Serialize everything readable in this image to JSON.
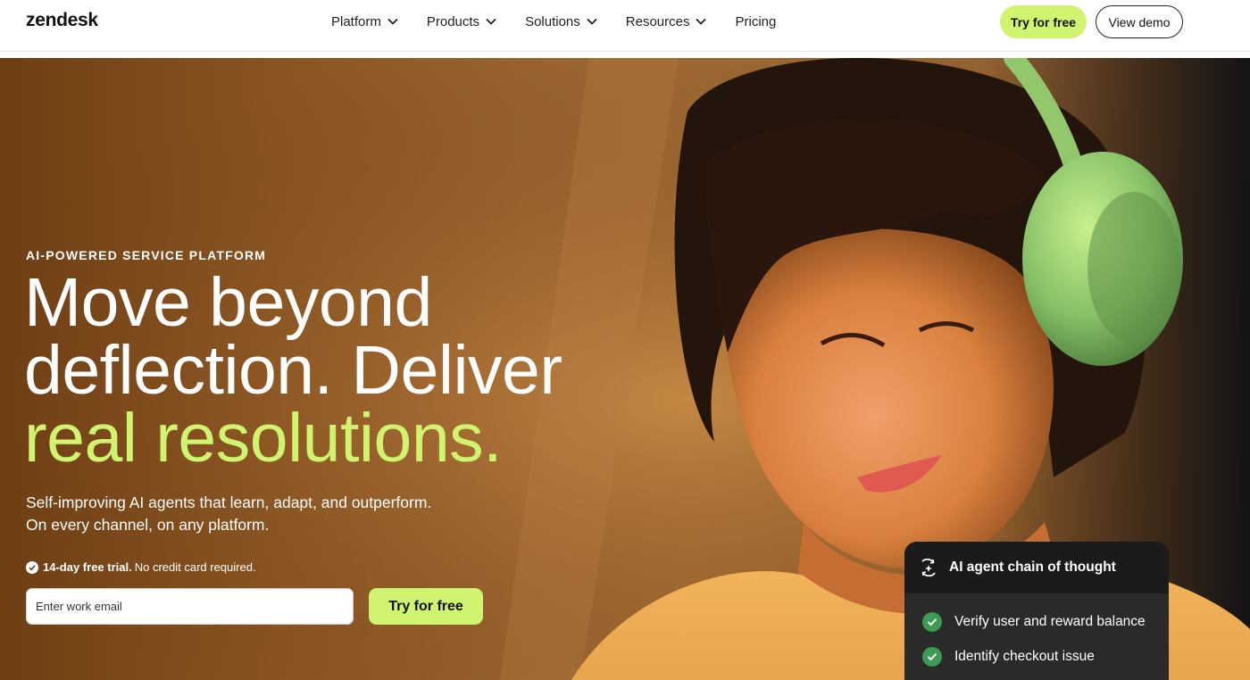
{
  "nav": {
    "logo": "zendesk",
    "menu": [
      {
        "label": "Platform",
        "dropdown": true
      },
      {
        "label": "Products",
        "dropdown": true
      },
      {
        "label": "Solutions",
        "dropdown": true
      },
      {
        "label": "Resources",
        "dropdown": true
      },
      {
        "label": "Pricing",
        "dropdown": false
      }
    ],
    "primary_button": "Try for free",
    "secondary_button": "View demo"
  },
  "hero": {
    "eyebrow": "AI-POWERED SERVICE PLATFORM",
    "headline_line1": "Move beyond",
    "headline_line2": "deflection. Deliver",
    "headline_accent": "real resolutions.",
    "subtext_line1": "Self-improving AI agents that learn, adapt, and outperform.",
    "subtext_line2": "On every channel, on any platform.",
    "trial_bold": "14-day free trial.",
    "trial_rest": "No credit card required.",
    "email_placeholder": "Enter work email",
    "cta": "Try for free",
    "image_alt": "Woman wearing green headphones smiling while looking down"
  },
  "ai_card": {
    "title": "AI agent chain of thought",
    "steps": [
      "Verify user and reward balance",
      "Identify checkout issue"
    ]
  },
  "colors": {
    "accent_lime": "#d1f470",
    "check_green": "#3d9a54",
    "card_dark": "#1b1b1b"
  }
}
